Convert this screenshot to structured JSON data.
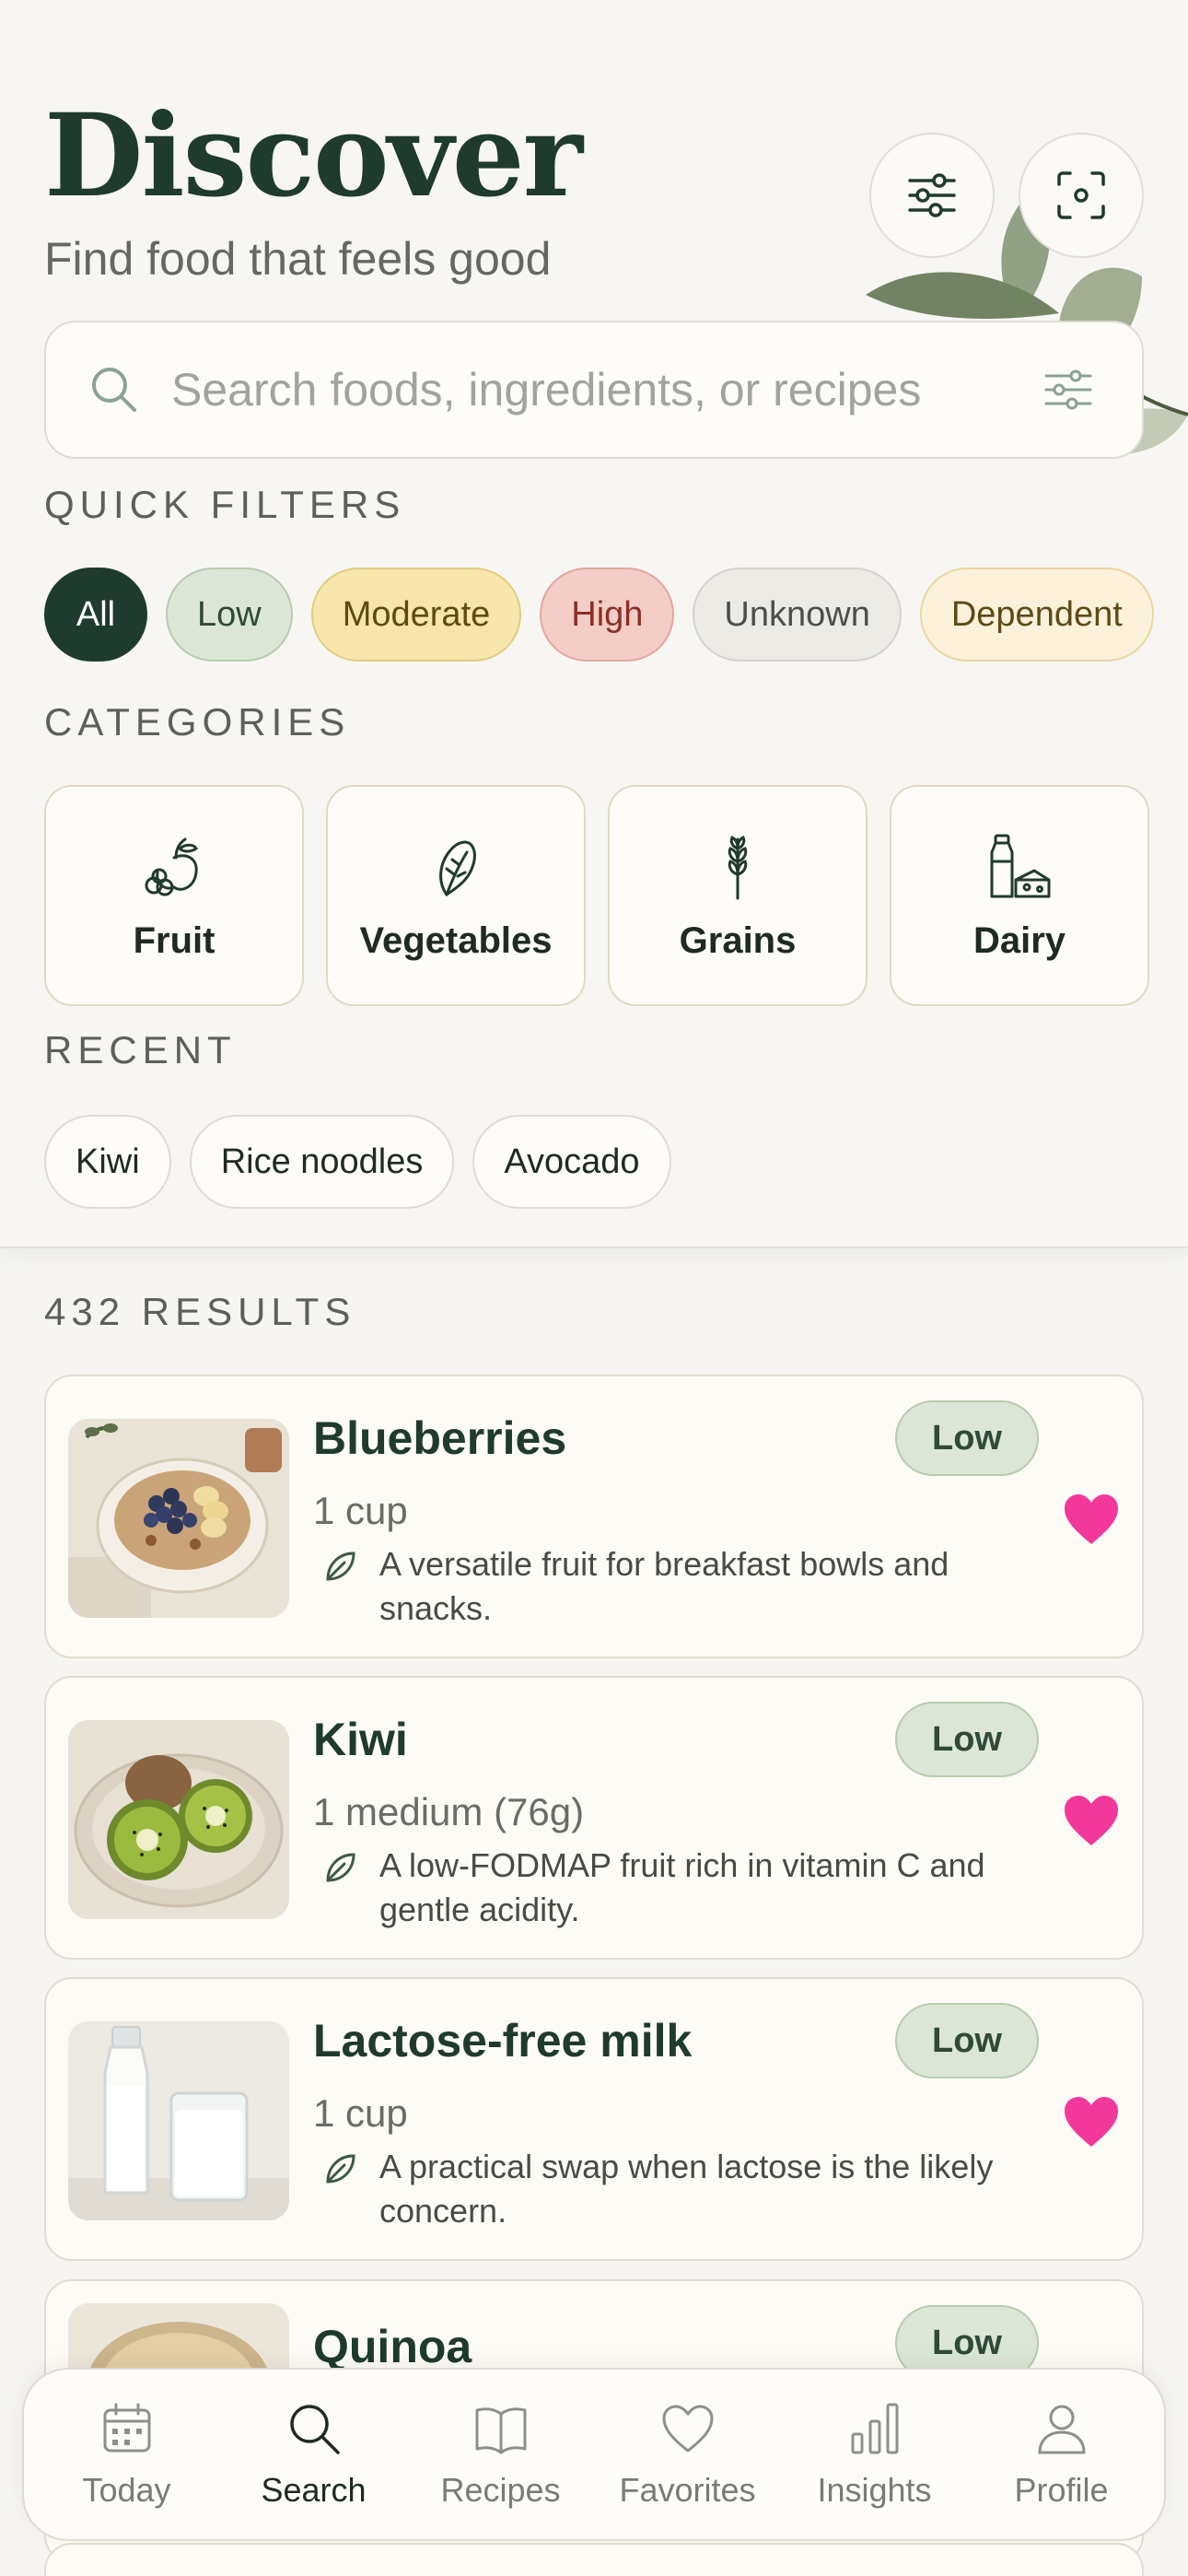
{
  "header": {
    "title": "Discover",
    "subtitle": "Find food that feels good"
  },
  "search": {
    "placeholder": "Search foods, ingredients, or recipes"
  },
  "quick_filters": {
    "label": "QUICK FILTERS",
    "chips": [
      "All",
      "Low",
      "Moderate",
      "High",
      "Unknown",
      "Dependent"
    ],
    "selected": "All"
  },
  "categories": {
    "label": "CATEGORIES",
    "items": [
      {
        "label": "Fruit",
        "icon": "fruit-icon"
      },
      {
        "label": "Vegetables",
        "icon": "vegetable-icon"
      },
      {
        "label": "Grains",
        "icon": "grain-icon"
      },
      {
        "label": "Dairy",
        "icon": "dairy-icon"
      }
    ]
  },
  "recent": {
    "label": "RECENT",
    "items": [
      "Kiwi",
      "Rice noodles",
      "Avocado"
    ]
  },
  "results": {
    "label": "432 RESULTS",
    "items": [
      {
        "name": "Blueberries",
        "serving": "1 cup",
        "description": "A versatile fruit for breakfast bowls and snacks.",
        "badge": "Low",
        "favorite": true
      },
      {
        "name": "Kiwi",
        "serving": "1 medium (76g)",
        "description": "A low-FODMAP fruit rich in vitamin C and gentle acidity.",
        "badge": "Low",
        "favorite": true
      },
      {
        "name": "Lactose-free milk",
        "serving": "1 cup",
        "description": "A practical swap when lactose is the likely concern.",
        "badge": "Low",
        "favorite": true
      },
      {
        "name": "Quinoa",
        "serving": "",
        "description": "",
        "badge": "Low",
        "favorite": true
      }
    ]
  },
  "tabbar": {
    "items": [
      "Today",
      "Search",
      "Recipes",
      "Favorites",
      "Insights",
      "Profile"
    ],
    "active": "Search"
  },
  "colors": {
    "primary": "#1f3a2e",
    "background": "#f6f5f1",
    "heart": "#f2399b",
    "low_badge": "#dbe6d6"
  }
}
